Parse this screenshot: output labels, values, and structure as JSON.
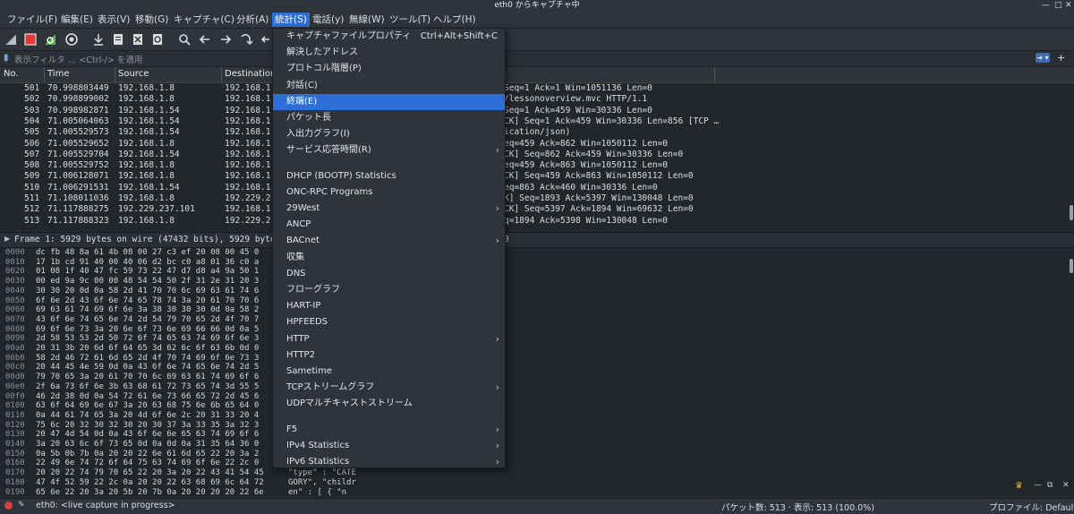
{
  "window": {
    "title": "eth0 からキャプチャ中"
  },
  "menubar": [
    {
      "label": "ファイル(F)"
    },
    {
      "label": "編集(E)"
    },
    {
      "label": "表示(V)"
    },
    {
      "label": "移動(G)"
    },
    {
      "label": "キャプチャ(C)"
    },
    {
      "label": "分析(A)"
    },
    {
      "label": "統計(S)"
    },
    {
      "label": "電話(y)"
    },
    {
      "label": "無線(W)"
    },
    {
      "label": "ツール(T)"
    },
    {
      "label": "ヘルプ(H)"
    }
  ],
  "filter": {
    "placeholder": "表示フィルタ … <Ctrl-/> を適用"
  },
  "packet_list": {
    "columns": [
      "No.",
      "Time",
      "Source",
      "Destination"
    ],
    "rows": [
      {
        "no": "501",
        "time": "70.998803449",
        "src": "192.168.1.8",
        "dst": "192.168.1",
        "info": "Seq=1 Ack=1 Win=1051136 Len=0"
      },
      {
        "no": "502",
        "time": "70.998899002",
        "src": "192.168.1.8",
        "dst": "192.168.1",
        "info": "/lessonoverview.mvc HTTP/1.1"
      },
      {
        "no": "503",
        "time": "70.998982871",
        "src": "192.168.1.54",
        "dst": "192.168.1",
        "info": "Seq=1 Ack=459 Win=30336 Len=0"
      },
      {
        "no": "504",
        "time": "71.005064063",
        "src": "192.168.1.54",
        "dst": "192.168.1",
        "info": "CK] Seq=1 Ack=459 Win=30336 Len=856 [TCP …"
      },
      {
        "no": "505",
        "time": "71.005529573",
        "src": "192.168.1.54",
        "dst": "192.168.1",
        "info": "ication/json)"
      },
      {
        "no": "506",
        "time": "71.005529652",
        "src": "192.168.1.8",
        "dst": "192.168.1",
        "info": "eq=459 Ack=862 Win=1050112 Len=0"
      },
      {
        "no": "507",
        "time": "71.005529704",
        "src": "192.168.1.54",
        "dst": "192.168.1",
        "info": "CK] Seq=862 Ack=459 Win=30336 Len=0"
      },
      {
        "no": "508",
        "time": "71.005529752",
        "src": "192.168.1.8",
        "dst": "192.168.1",
        "info": "eq=459 Ack=863 Win=1050112 Len=0"
      },
      {
        "no": "509",
        "time": "71.006128071",
        "src": "192.168.1.8",
        "dst": "192.168.1",
        "info": "CK] Seq=459 Ack=863 Win=1050112 Len=0"
      },
      {
        "no": "510",
        "time": "71.006291531",
        "src": "192.168.1.54",
        "dst": "192.168.1",
        "info": "eq=863 Ack=460 Win=30336 Len=0"
      },
      {
        "no": "511",
        "time": "71.108011036",
        "src": "192.168.1.8",
        "dst": "192.229.2",
        "info": "K] Seq=1893 Ack=5397 Win=130048 Len=0"
      },
      {
        "no": "512",
        "time": "71.117888275",
        "src": "192.229.237.101",
        "dst": "192.168.1",
        "info": "CK] Seq=5397 Ack=1894 Win=69632 Len=0"
      },
      {
        "no": "513",
        "time": "71.117888323",
        "src": "192.168.1.8",
        "dst": "192.229.2",
        "info": "q=1894 Ack=5398 Win=130048 Len=0"
      }
    ]
  },
  "detail": {
    "frame_text": "Frame 1: 5929 bytes on wire (47432 bits), 5929 byte",
    "frame_tail": "0"
  },
  "bytes": {
    "rows": [
      {
        "off": "0000",
        "hex": "dc fb 48 8a 61 4b 08 00  27 c3 ef 20 08 00 45 0",
        "asc": ""
      },
      {
        "off": "0010",
        "hex": "17 1b cd 91 40 00 40 06  d2 bc c0 a8 01 36 c0 a",
        "asc": ""
      },
      {
        "off": "0020",
        "hex": "01 08 1f 40 47 fc 59 73  22 47 d7 d8 a4 9a 50 1",
        "asc": ""
      },
      {
        "off": "0030",
        "hex": "00 ed 9a 9c 00 00 48 54  54 50 2f 31 2e 31 20 3",
        "asc": ""
      },
      {
        "off": "0040",
        "hex": "30 30 20 0d 0a 58 2d 41  70 70 6c 69 63 61 74 6",
        "asc": ""
      },
      {
        "off": "0050",
        "hex": "6f 6e 2d 43 6f 6e 74 65  78 74 3a 20 61 70 70 6",
        "asc": ""
      },
      {
        "off": "0060",
        "hex": "69 63 61 74 69 6f 6e 3a  38 30 30 30 0d 0a 58 2",
        "asc": ""
      },
      {
        "off": "0070",
        "hex": "43 6f 6e 74 65 6e 74 2d  54 79 70 65 2d 4f 70 7",
        "asc": ""
      },
      {
        "off": "0080",
        "hex": "69 6f 6e 73 3a 20 6e 6f  73 6e 69 66 66 0d 0a 5",
        "asc": ""
      },
      {
        "off": "0090",
        "hex": "2d 58 53 53 2d 50 72 6f  74 65 63 74 69 6f 6e 3",
        "asc": ""
      },
      {
        "off": "00a0",
        "hex": "20 31 3b 20 6d 6f 64 65  3d 62 6c 6f 63 6b 0d 0",
        "asc": ""
      },
      {
        "off": "00b0",
        "hex": "58 2d 46 72 61 6d 65 2d  4f 70 74 69 6f 6e 73 3",
        "asc": ""
      },
      {
        "off": "00c0",
        "hex": "20 44 45 4e 59 0d 0a 43  6f 6e 74 65 6e 74 2d 5",
        "asc": ""
      },
      {
        "off": "00d0",
        "hex": "79 70 65 3a 20 61 70 70  6c 69 63 61 74 69 6f 6",
        "asc": ""
      },
      {
        "off": "00e0",
        "hex": "2f 6a 73 6f 6e 3b 63 68  61 72 73 65 74 3d 55 5",
        "asc": ""
      },
      {
        "off": "00f0",
        "hex": "46 2d 38 0d 0a 54 72 61  6e 73 66 65 72 2d 45 6",
        "asc": ""
      },
      {
        "off": "0100",
        "hex": "63 6f 64 69 6e 67 3a 20  63 68 75 6e 6b 65 64 0",
        "asc": ""
      },
      {
        "off": "0110",
        "hex": "0a 44 61 74 65 3a 20 4d  6f 6e 2c 20 31 33 20 4",
        "asc": ""
      },
      {
        "off": "0120",
        "hex": "75 6c 20 32 30 32 30 20  30 37 3a 33 35 3a 32 3",
        "asc": ""
      },
      {
        "off": "0130",
        "hex": "20 47 4d 54 0d 0a 43 6f  6e 6e 65 63 74 69 6f 6",
        "asc": ""
      },
      {
        "off": "0140",
        "hex": "3a 20 63 6c 6f 73 65 0d  0a 0d 0a 31 35 64 36 0",
        "asc": ""
      },
      {
        "off": "0150",
        "hex": "0a 5b 0b 7b 0a 20 20 22  6e 61 6d 65 22 20 3a 2",
        "asc": ""
      },
      {
        "off": "0160",
        "hex": "22 49 6e 74 72 6f 64 75  63 74 69 6f 6e 22 2c 0",
        "asc": ""
      },
      {
        "off": "0170",
        "hex": "20 20 22 74 79 70 65 22  20 3a 20 22 43 41 54 45",
        "asc": "  \"type\"  : \"CATE"
      },
      {
        "off": "0180",
        "hex": "47 4f 52 59 22 2c 0a 20  20 22 63 68 69 6c 64 72",
        "asc": "GORY\",   \"childr"
      },
      {
        "off": "0190",
        "hex": "65 6e 22 20 3a 20 5b 20  7b 0a 20 20 20 20 22 6e",
        "asc": "en\" : [  {     \"n"
      }
    ]
  },
  "statusbar": {
    "capture": "eth0: <live capture in progress>",
    "packets": "パケット数: 513 · 表示: 513 (100.0%)",
    "profile": "プロファイル: Default"
  },
  "stats_menu": {
    "items": [
      {
        "label": "キャプチャファイルプロパティ",
        "shortcut": "Ctrl+Alt+Shift+C"
      },
      {
        "label": "解決したアドレス"
      },
      {
        "label": "プロトコル階層(P)"
      },
      {
        "label": "対話(C)"
      },
      {
        "label": "終端(E)",
        "highlighted": true
      },
      {
        "label": "パケット長"
      },
      {
        "label": "入出力グラフ(I)"
      },
      {
        "label": "サービス応答時間(R)",
        "submenu": true
      },
      {
        "label": "DHCP (BOOTP) Statistics"
      },
      {
        "label": "ONC-RPC Programs"
      },
      {
        "label": "29West",
        "submenu": true
      },
      {
        "label": "ANCP"
      },
      {
        "label": "BACnet",
        "submenu": true
      },
      {
        "label": "収集"
      },
      {
        "label": "DNS"
      },
      {
        "label": "フローグラフ"
      },
      {
        "label": "HART-IP"
      },
      {
        "label": "HPFEEDS"
      },
      {
        "label": "HTTP",
        "submenu": true
      },
      {
        "label": "HTTP2"
      },
      {
        "label": "Sametime"
      },
      {
        "label": "TCPストリームグラフ",
        "submenu": true
      },
      {
        "label": "UDPマルチキャストストリーム"
      },
      {
        "label": "F5",
        "submenu": true
      },
      {
        "label": "IPv4 Statistics",
        "submenu": true
      },
      {
        "label": "IPv6 Statistics",
        "submenu": true
      }
    ]
  },
  "colors": {
    "accent": "#2d6fd6",
    "background": "#272b30"
  }
}
